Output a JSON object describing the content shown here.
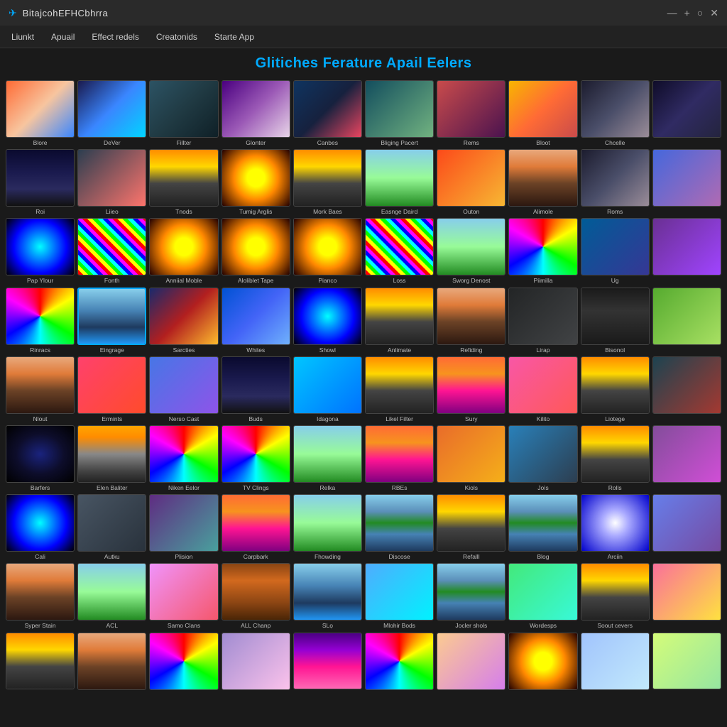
{
  "titleBar": {
    "icon": "✈",
    "title": "BitajcohEFHCbhrra",
    "controls": [
      "—",
      "+",
      "○",
      "✕"
    ]
  },
  "menuBar": {
    "items": [
      "Liunkt",
      "Apuail",
      "Effect redels",
      "Creatonids",
      "Starte App"
    ]
  },
  "pageHeader": {
    "title": "Glitiches Ferature Apail Eelers"
  },
  "grid": {
    "items": [
      {
        "label": "Blore",
        "bg": "g1"
      },
      {
        "label": "DeVer",
        "bg": "g2"
      },
      {
        "label": "Fillter",
        "bg": "g3"
      },
      {
        "label": "Glonter",
        "bg": "g4"
      },
      {
        "label": "Canbes",
        "bg": "g5"
      },
      {
        "label": "Bliging Pacert",
        "bg": "g6"
      },
      {
        "label": "Rems",
        "bg": "g7"
      },
      {
        "label": "Bloot",
        "bg": "g8"
      },
      {
        "label": "Chcelle",
        "bg": "g9"
      },
      {
        "label": "",
        "bg": "g10"
      },
      {
        "label": "Roi",
        "bg": "city-bg"
      },
      {
        "label": "Liieo",
        "bg": "g11"
      },
      {
        "label": "Tnods",
        "bg": "road-bg"
      },
      {
        "label": "Tumig Arglis",
        "bg": "g32"
      },
      {
        "label": "Mork Baes",
        "bg": "road-bg"
      },
      {
        "label": "Easnge Daird",
        "bg": "green-field"
      },
      {
        "label": "Outon",
        "bg": "g13"
      },
      {
        "label": "Alimole",
        "bg": "mountain-bg"
      },
      {
        "label": "Roms",
        "bg": "g9"
      },
      {
        "label": "",
        "bg": "g14"
      },
      {
        "label": "Pap Ylour",
        "bg": "g33"
      },
      {
        "label": "Fonth",
        "bg": "stripe-bg"
      },
      {
        "label": "Anniial Moble",
        "bg": "g32"
      },
      {
        "label": "Aloliblet Tape",
        "bg": "g32"
      },
      {
        "label": "Pianco",
        "bg": "g32"
      },
      {
        "label": "Loss",
        "bg": "stripe-bg"
      },
      {
        "label": "Sworg Denost",
        "bg": "green-field"
      },
      {
        "label": "Piimilla",
        "bg": "rainbow-burst"
      },
      {
        "label": "Ug",
        "bg": "g15"
      },
      {
        "label": "",
        "bg": "g16"
      },
      {
        "label": "Rinracs",
        "bg": "rainbow-burst"
      },
      {
        "label": "Eingrage",
        "bg": "lake-bg",
        "highlighted": true
      },
      {
        "label": "Sarcties",
        "bg": "g17"
      },
      {
        "label": "Whites",
        "bg": "g18"
      },
      {
        "label": "Showl",
        "bg": "g33"
      },
      {
        "label": "Anlimate",
        "bg": "road-bg"
      },
      {
        "label": "Refiding",
        "bg": "mountain-bg"
      },
      {
        "label": "Lirap",
        "bg": "g19"
      },
      {
        "label": "Bisonol",
        "bg": "dark-arch"
      },
      {
        "label": "",
        "bg": "g20"
      },
      {
        "label": "Nlout",
        "bg": "mountain-bg"
      },
      {
        "label": "Ermints",
        "bg": "g21"
      },
      {
        "label": "Nerso Cast",
        "bg": "g22"
      },
      {
        "label": "Buds",
        "bg": "city-bg"
      },
      {
        "label": "Idagona",
        "bg": "g23"
      },
      {
        "label": "Likel Filter",
        "bg": "road-bg"
      },
      {
        "label": "Sury",
        "bg": "sunset-bg"
      },
      {
        "label": "Kilito",
        "bg": "g24"
      },
      {
        "label": "Liotege",
        "bg": "road-bg"
      },
      {
        "label": "",
        "bg": "g25"
      },
      {
        "label": "Barfers",
        "bg": "space-bg"
      },
      {
        "label": "Elen Baliter",
        "bg": "road2-bg"
      },
      {
        "label": "Niken Eelor",
        "bg": "rainbow-burst"
      },
      {
        "label": "TV Clings",
        "bg": "rainbow-burst"
      },
      {
        "label": "Relka",
        "bg": "green-field"
      },
      {
        "label": "RBEs",
        "bg": "sunset-bg"
      },
      {
        "label": "Kiols",
        "bg": "g26"
      },
      {
        "label": "Joìs",
        "bg": "g27"
      },
      {
        "label": "Rolls",
        "bg": "road-bg"
      },
      {
        "label": "",
        "bg": "g28"
      },
      {
        "label": "Cali",
        "bg": "g33"
      },
      {
        "label": "Autku",
        "bg": "g29"
      },
      {
        "label": "Plision",
        "bg": "g30"
      },
      {
        "label": "Carpbark",
        "bg": "sunset-bg"
      },
      {
        "label": "Fhowding",
        "bg": "green-field"
      },
      {
        "label": "Discose",
        "bg": "mtn-lake"
      },
      {
        "label": "Refalll",
        "bg": "road-bg"
      },
      {
        "label": "Blog",
        "bg": "mtn-lake"
      },
      {
        "label": "Arciin",
        "bg": "g31"
      },
      {
        "label": "",
        "bg": "g35"
      },
      {
        "label": "Syper Stain",
        "bg": "mountain-bg"
      },
      {
        "label": "ACL",
        "bg": "green-field"
      },
      {
        "label": "Samo Clans",
        "bg": "g36"
      },
      {
        "label": "ALL Chanp",
        "bg": "hallway-bg"
      },
      {
        "label": "SLọ",
        "bg": "lake-bg"
      },
      {
        "label": "Mlohir Bods",
        "bg": "g37"
      },
      {
        "label": "Jocler shols",
        "bg": "mtn-lake"
      },
      {
        "label": "Wordesps",
        "bg": "g38"
      },
      {
        "label": "Soout cevers",
        "bg": "road-bg"
      },
      {
        "label": "",
        "bg": "g39"
      },
      {
        "label": "",
        "bg": "road-bg"
      },
      {
        "label": "",
        "bg": "mountain-bg"
      },
      {
        "label": "",
        "bg": "rainbow-burst"
      },
      {
        "label": "",
        "bg": "g40"
      },
      {
        "label": "",
        "bg": "pink-city"
      },
      {
        "label": "",
        "bg": "rainbow-burst"
      },
      {
        "label": "",
        "bg": "g41"
      },
      {
        "label": "",
        "bg": "g32"
      },
      {
        "label": "",
        "bg": "g42"
      },
      {
        "label": "",
        "bg": "g43"
      }
    ]
  }
}
